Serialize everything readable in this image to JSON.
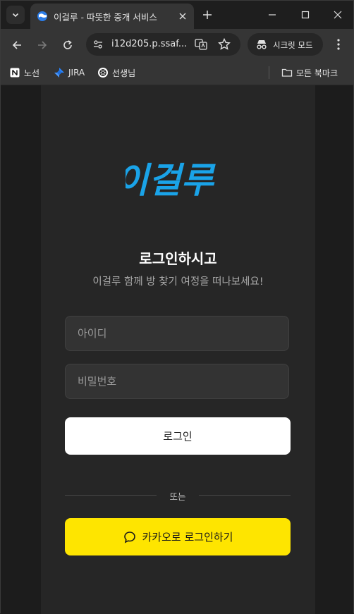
{
  "browser": {
    "tab": {
      "title": "이걸루 - 따뜻한 중개 서비스",
      "favicon": "globe-icon"
    },
    "address": {
      "url": "i12d205.p.ssaf..."
    },
    "incognito_label": "시크릿 모드",
    "bookmarks": [
      {
        "label": "노선",
        "icon": "notion-icon"
      },
      {
        "label": "JIRA",
        "icon": "jira-icon"
      },
      {
        "label": "선생님",
        "icon": "openai-icon"
      }
    ],
    "all_bookmarks_label": "모든 북마크"
  },
  "page": {
    "logo_text": "이걸루",
    "heading": "로그인하시고",
    "subtitle": "이걸루 함께 방 찾기 여정을 떠나보세요!",
    "id_placeholder": "아이디",
    "password_placeholder": "비밀번호",
    "login_label": "로그인",
    "divider_label": "또는",
    "kakao_label": "카카오로 로그인하기"
  },
  "colors": {
    "logo_blue": "#1aa3e8",
    "kakao_yellow": "#fee500",
    "card_bg": "#262626"
  }
}
